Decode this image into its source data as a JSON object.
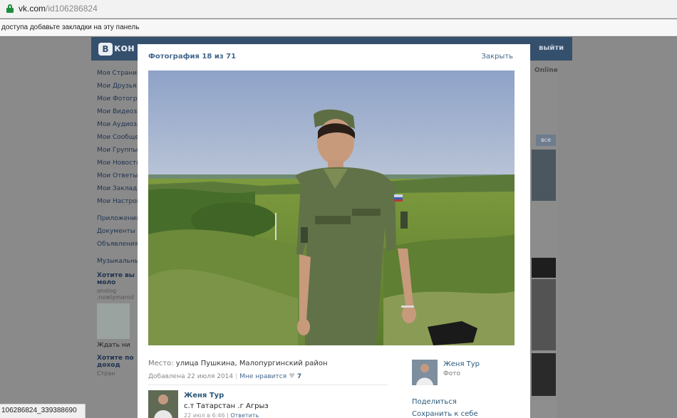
{
  "browser": {
    "url_host": "vk.com",
    "url_path": "/id106286824",
    "bookmark_hint": "доступа добавьте закладки на эту панель",
    "status_url": "106286824_339388690"
  },
  "vk": {
    "logo_letter": "В",
    "logo_name": "кон",
    "logout": "выйти",
    "online": "Online",
    "all_button": "все"
  },
  "left_menu": [
    "Моя Страница",
    "Мои Друзья",
    "Мои Фотографии",
    "Мои Видеозаписи",
    "Мои Аудиозаписи",
    "Мои Сообщения",
    "Мои Группы",
    "Мои Новости",
    "Мои Ответы",
    "Мои Закладки",
    "Мои Настройки"
  ],
  "left_menu_2": [
    "Приложения",
    "Документы",
    "Объявления"
  ],
  "left_menu_3": [
    "Музыкальный"
  ],
  "promo": {
    "title": "Хотите вы моло",
    "line1": "onolog",
    "line2": ".nowlymarod",
    "price": "Ждать ни",
    "title2": "Хотите по доход",
    "line3": "Стран"
  },
  "viewer": {
    "title": "Фотография 18 из 71",
    "close": "Закрыть",
    "place_label": "Место:",
    "place": "улица Пушкина, Малопургинский район",
    "added": "Добавлена 22 июля 2014",
    "like_label": "Мне нравится",
    "like_count": "7",
    "owner_name": "Женя Тур",
    "owner_sub": "Фото",
    "share": "Поделиться",
    "save": "Сохранить к себе",
    "comment": {
      "author": "Женя Тур",
      "text": "с.т Татарстан .г Агрыз",
      "time": "22 июл в 6:46",
      "reply": "Ответить"
    }
  },
  "colors": {
    "vk_header": "#35506d",
    "link": "#2b587a",
    "overlay": "#8a8a8a"
  }
}
